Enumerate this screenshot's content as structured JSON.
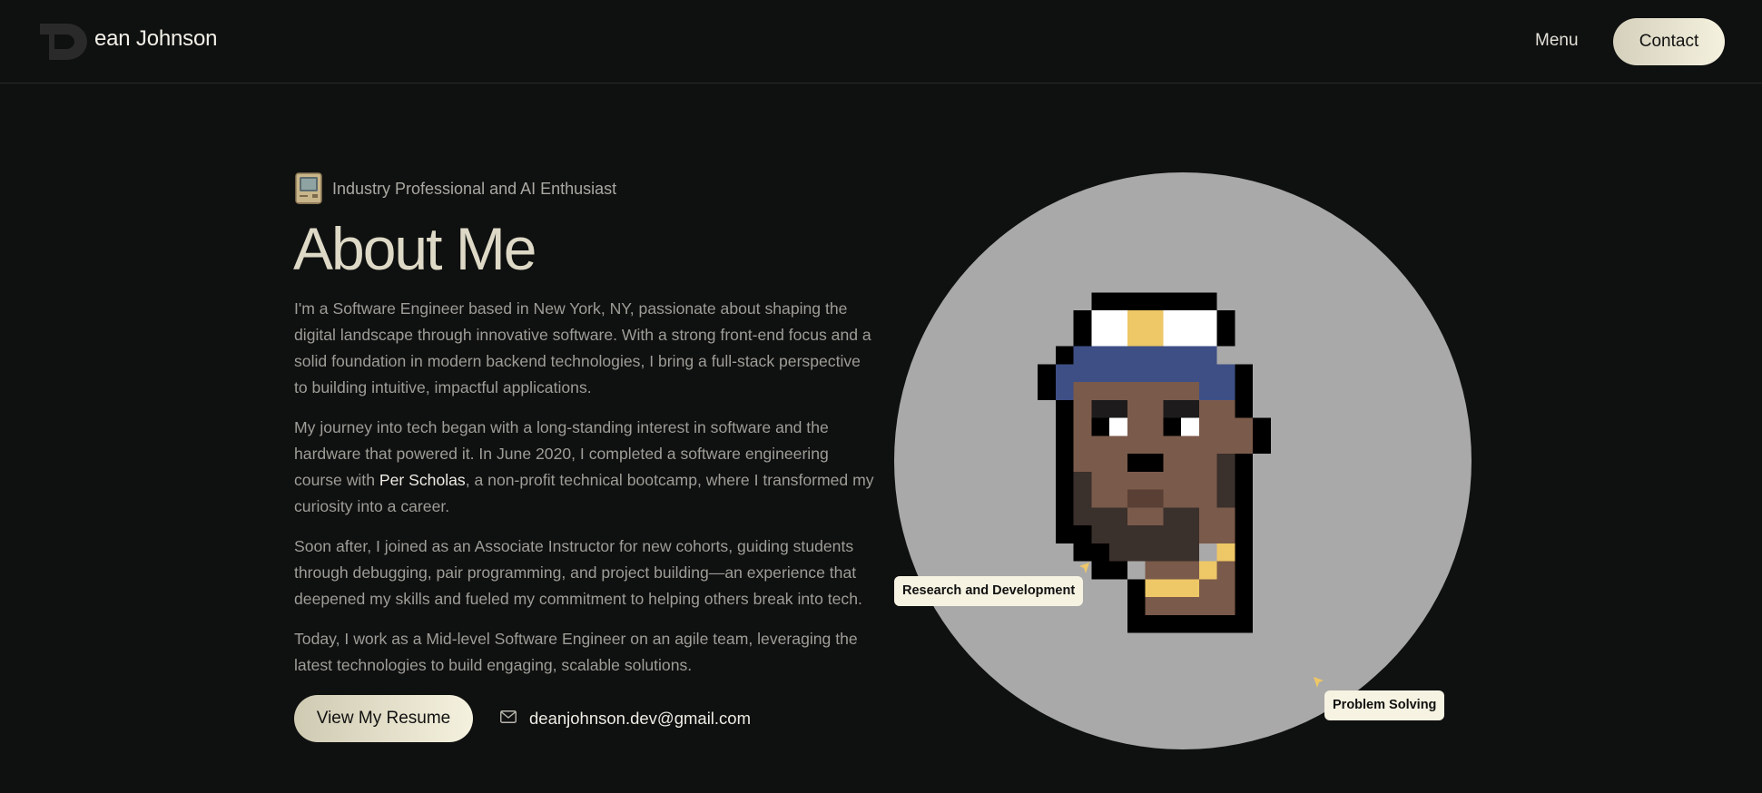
{
  "header": {
    "brand_name": "ean Johnson",
    "menu_label": "Menu",
    "contact_label": "Contact"
  },
  "hero": {
    "tagline": "Industry Professional and AI Enthusiast",
    "title": "About Me",
    "paragraphs": {
      "p1": "I'm a Software Engineer based in New York, NY, passionate about shaping the digital landscape through innovative software. With a strong front-end focus and a solid foundation in modern backend technologies, I bring a full-stack perspective to building intuitive, impactful applications.",
      "p2_before": "My journey into tech began with a long-standing interest in software and the hardware that powered it. In June 2020, I completed a software engineering course with ",
      "p2_highlight": "Per Scholas",
      "p2_after": ", a non-profit technical bootcamp, where I transformed my curiosity into a career.",
      "p3": "Soon after, I joined as an Associate Instructor for new cohorts, guiding students through debugging, pair programming, and project building—an experience that deepened my skills and fueled my commitment to helping others break into tech.",
      "p4": "Today, I work as a Mid-level Software Engineer on an agile team, leveraging the latest technologies to build engaging, scalable solutions."
    },
    "resume_label": "View My Resume",
    "email": "deanjohnson.dev@gmail.com"
  },
  "avatar": {
    "badge_left": "Research and Development",
    "badge_right": "Problem Solving"
  },
  "colors": {
    "background": "#0f1010",
    "accent_cream": "#f4f1de",
    "circle_gray": "#a9a9a9",
    "cap_blue": "#3e4f85",
    "gold": "#eec766",
    "skin": "#7a5a4a"
  },
  "icons": {
    "logo": "d-logo-icon",
    "computer": "retro-computer-icon",
    "mail": "envelope-icon",
    "pointer": "cursor-arrow-icon"
  }
}
